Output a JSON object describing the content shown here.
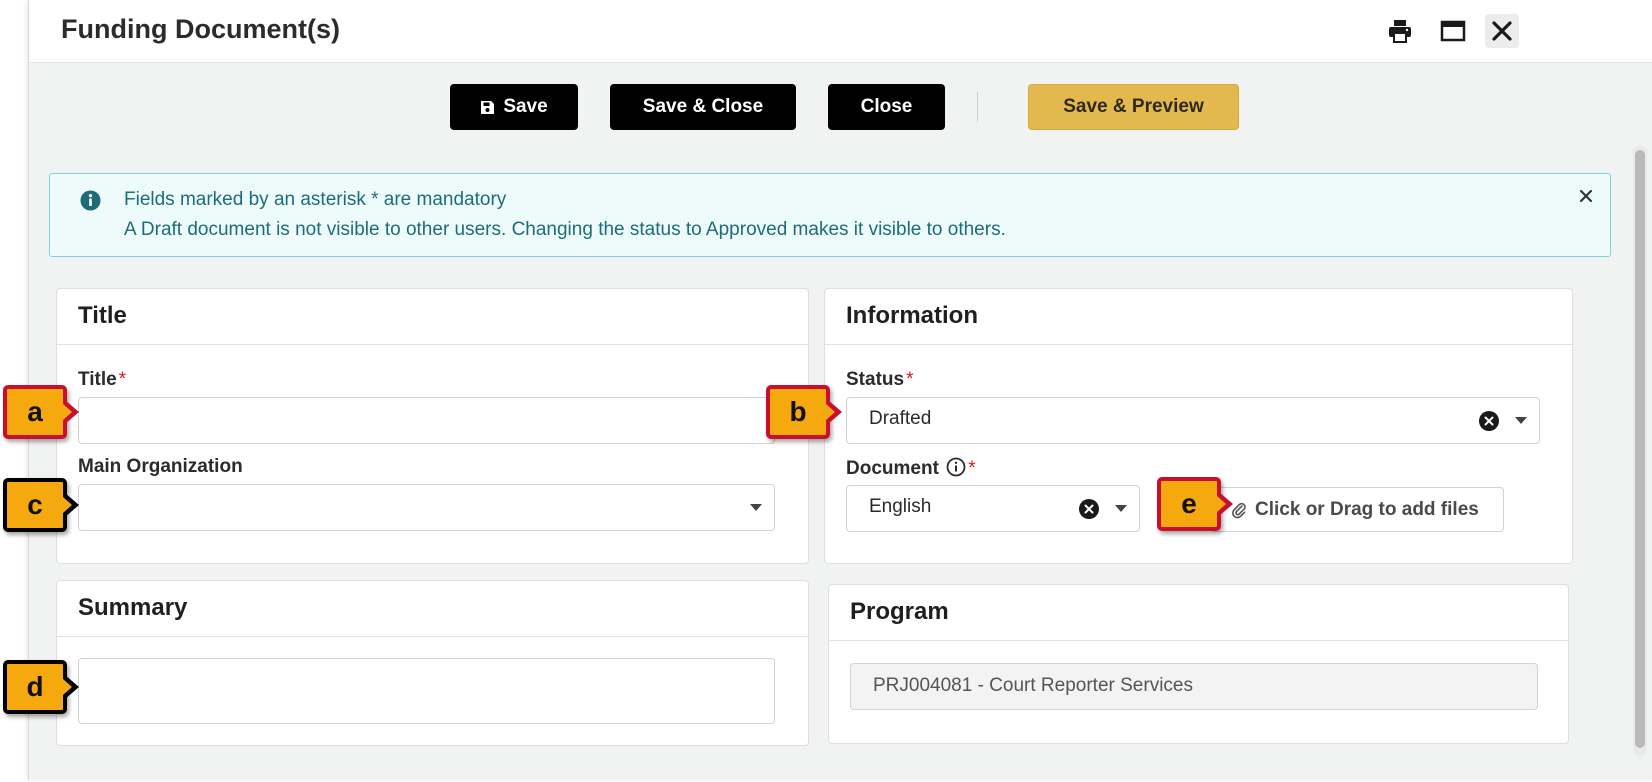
{
  "dialog": {
    "title": "Funding Document(s)",
    "header_icons": [
      "print-icon",
      "maximize-icon",
      "close-icon"
    ]
  },
  "toolbar": {
    "save_label": "Save",
    "save_close_label": "Save & Close",
    "close_label": "Close",
    "save_preview_label": "Save & Preview"
  },
  "alert": {
    "line1": "Fields marked by an asterisk * are mandatory",
    "line2": "A Draft document is not visible to other users. Changing the status to Approved makes it visible to others."
  },
  "title_card": {
    "heading": "Title",
    "title_label": "Title",
    "title_value": "",
    "org_label": "Main Organization",
    "org_value": ""
  },
  "summary_card": {
    "heading": "Summary",
    "summary_value": ""
  },
  "information_card": {
    "heading": "Information",
    "status_label": "Status",
    "status_value": "Drafted",
    "document_label": "Document",
    "document_language": "English",
    "upload_label": "Click or Drag to add files"
  },
  "program_card": {
    "heading": "Program",
    "program_value": "PRJ004081 - Court Reporter Services"
  },
  "callouts": {
    "a": "a",
    "b": "b",
    "c": "c",
    "d": "d",
    "e": "e"
  },
  "colors": {
    "primary_button": "#000000",
    "preview_button": "#e3b94f",
    "alert_bg": "#eefbfb",
    "alert_text": "#1e6c77",
    "required_asterisk": "#d0191f",
    "callout_fill": "#f6a90f",
    "callout_border_red": "#c8102e",
    "callout_border_black": "#000000"
  }
}
